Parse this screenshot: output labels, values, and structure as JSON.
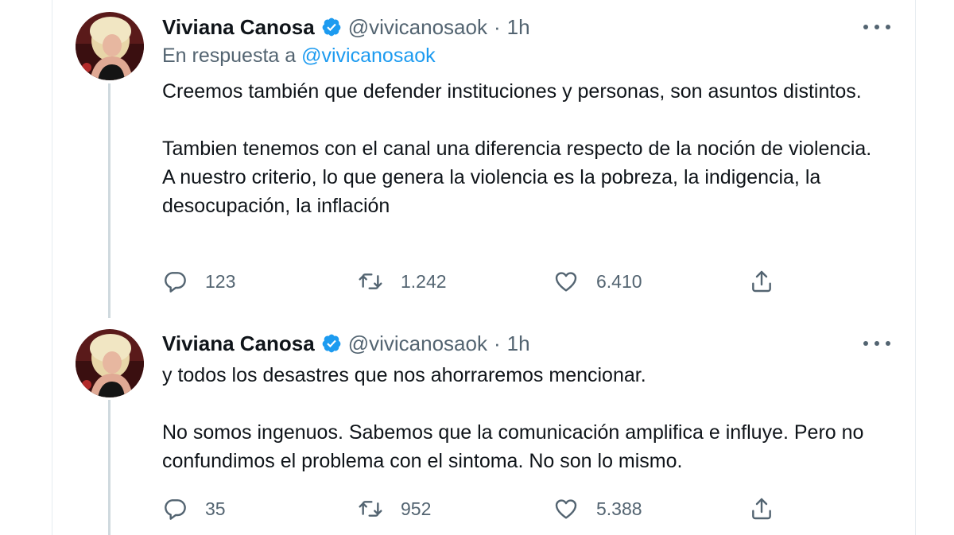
{
  "colors": {
    "text": "#0f1419",
    "secondary": "#536471",
    "link": "#1d9bf0",
    "verified": "#1d9bf0",
    "thread_line": "#cfd9de"
  },
  "tweets": [
    {
      "author_name": "Viviana Canosa",
      "handle": "@vivicanosaok",
      "separator": "·",
      "time": "1h",
      "verified_icon": "verified-badge-icon",
      "reply_prefix": "En respuesta a",
      "reply_mention": "@vivicanosaok",
      "paragraphs": [
        "Creemos también que defender instituciones y  personas, son asuntos distintos.",
        "Tambien tenemos con el canal una diferencia respecto de la noción de violencia. A nuestro criterio, lo que genera la violencia es la pobreza, la indigencia, la desocupación, la inflación"
      ],
      "replies": "123",
      "retweets": "1.242",
      "likes": "6.410"
    },
    {
      "author_name": "Viviana Canosa",
      "handle": "@vivicanosaok",
      "separator": "·",
      "time": "1h",
      "verified_icon": "verified-badge-icon",
      "paragraphs": [
        "y todos los desastres que nos ahorraremos mencionar.",
        "No somos ingenuos. Sabemos que la comunicación amplifica e influye. Pero no confundimos el problema con el sintoma. No son lo mismo."
      ],
      "replies": "35",
      "retweets": "952",
      "likes": "5.388"
    }
  ],
  "icons": {
    "reply": "reply-icon",
    "retweet": "retweet-icon",
    "like": "heart-icon",
    "share": "share-icon",
    "more": "more-icon"
  }
}
